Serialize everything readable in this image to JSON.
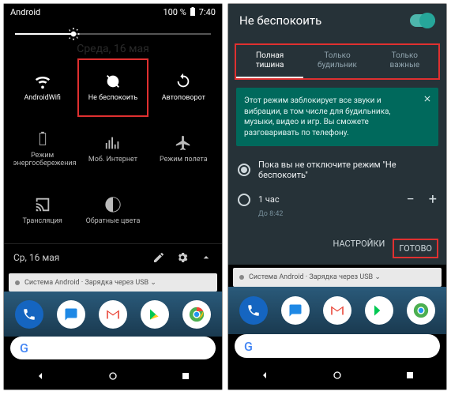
{
  "left": {
    "status": {
      "title": "Android",
      "battery": "100 %",
      "time": "7:40"
    },
    "ghost_date": "Среда, 16 мая",
    "tiles": [
      {
        "label": "AndroidWifi",
        "icon": "wifi",
        "on": true
      },
      {
        "label": "Не беспокоить",
        "icon": "dnd",
        "on": true,
        "highlight": true
      },
      {
        "label": "Автоповорот",
        "icon": "rotate",
        "on": true
      },
      {
        "label": "Режим энергосбережения",
        "icon": "battery",
        "on": false
      },
      {
        "label": "Моб. Интернет",
        "icon": "data",
        "on": false
      },
      {
        "label": "Режим полета",
        "icon": "airplane",
        "on": false
      },
      {
        "label": "Трансляция",
        "icon": "cast",
        "on": false
      },
      {
        "label": "Обратные цвета",
        "icon": "invert",
        "on": false
      }
    ],
    "footer_date": "Ср, 16 мая",
    "notif": "Система Android · Зарядка через USB ⌄"
  },
  "right": {
    "title": "Не беспокоить",
    "tabs": [
      {
        "line1": "Полная",
        "line2": "тишина",
        "active": true
      },
      {
        "line1": "Только",
        "line2": "будильник",
        "active": false
      },
      {
        "line1": "Только",
        "line2": "важные",
        "active": false
      }
    ],
    "info": "Этот режим заблокирует все звуки и вибрации, в том числе для будильника, музыки, видео и игр. Вы сможете разговаривать по телефону.",
    "radios": {
      "opt1": "Пока вы не отключите режим \"Не беспокоить\"",
      "opt2": "1 час",
      "opt2_sub": "До 8:42"
    },
    "actions": {
      "settings": "НАСТРОЙКИ",
      "done": "ГОТОВО"
    },
    "notif": "Система Android · Зарядка через USB ⌄"
  }
}
